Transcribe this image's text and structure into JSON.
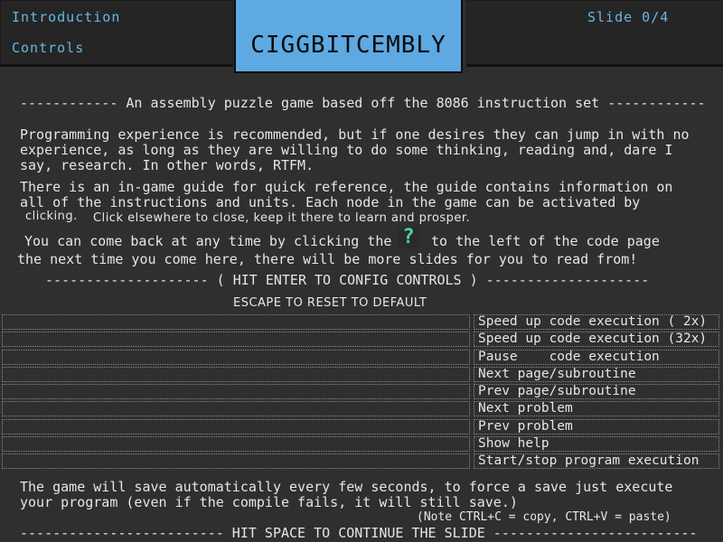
{
  "nav": {
    "introduction": "Introduction",
    "controls": "Controls",
    "slide_counter": "Slide 0/4",
    "title": "CIGGBITCEMBLY"
  },
  "content": {
    "subtitle": "------------ An assembly puzzle game based off the 8086 instruction set ------------",
    "para1": [
      "Programming experience is recommended, but if one desires they can jump in with no",
      "experience, as long as they are willing to do some thinking, reading and, dare I",
      "say, research. In other words, RTFM."
    ],
    "para2": [
      "There is an in-game guide for quick reference, the guide contains information on",
      "all of the instructions and units. Each node in the game can be activated by"
    ],
    "para2_small_a": "clicking.",
    "para2_small_b": "Click elsewhere to close, keep it there to learn and prosper.",
    "para3_a": "You can come back at any time by clicking the",
    "help_icon": "?",
    "para3_b": "to the left of the code page",
    "para3_line2": "the next time you come here, there will be more slides for you to read from!",
    "config_header": "-------------------- ( HIT ENTER TO CONFIG CONTROLS ) --------------------",
    "escape_note": "ESCAPE TO RESET TO DEFAULT"
  },
  "controls": [
    {
      "key": "",
      "label": "Speed up code execution ( 2x)"
    },
    {
      "key": "",
      "label": "Speed up code execution (32x)"
    },
    {
      "key": "",
      "label": "Pause    code execution"
    },
    {
      "key": "",
      "label": "Next page/subroutine"
    },
    {
      "key": "",
      "label": "Prev page/subroutine"
    },
    {
      "key": "",
      "label": "Next problem"
    },
    {
      "key": "",
      "label": "Prev problem"
    },
    {
      "key": "",
      "label": "Show help"
    },
    {
      "key": "",
      "label": "Start/stop program execution"
    }
  ],
  "footer": {
    "save_line1": "The game will save automatically every few seconds, to force a save just execute",
    "save_line2": "your program (even if the compile fails, it will still save.)",
    "note": "(Note CTRL+C = copy, CTRL+V = paste)",
    "continue": "------------------------- HIT SPACE TO CONTINUE THE SLIDE -------------------------"
  },
  "colors": {
    "background": "#2f2f2f",
    "nav_text": "#67b7e6",
    "title_box": "#5ea9e2",
    "help_icon": "#4fd1a8"
  }
}
